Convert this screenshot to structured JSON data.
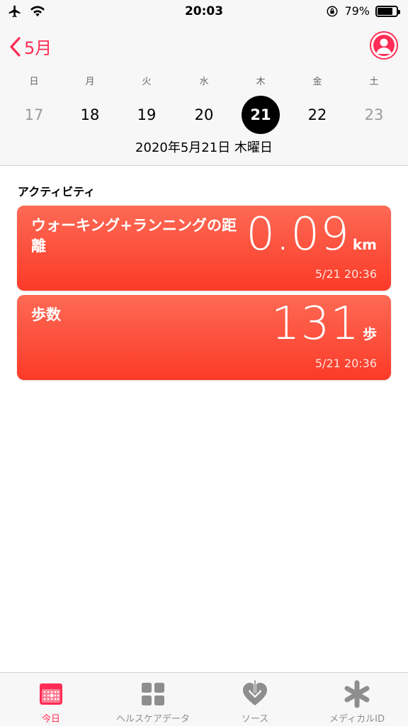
{
  "status": {
    "time": "20:03",
    "battery": "79%",
    "battery_level": 0.79
  },
  "header": {
    "back_label": "5月",
    "weekdays": [
      "日",
      "月",
      "火",
      "水",
      "木",
      "金",
      "土"
    ],
    "dates": [
      "17",
      "18",
      "19",
      "20",
      "21",
      "22",
      "23"
    ],
    "selected_date": "21",
    "full_date": "2020年5月21日 木曜日"
  },
  "section": {
    "title": "アクティビティ"
  },
  "cards": [
    {
      "title": "ウォーキング+ランニングの距離",
      "value": "0.09",
      "unit": "km",
      "timestamp": "5/21 20:36"
    },
    {
      "title": "歩数",
      "value": "131",
      "unit": "歩",
      "timestamp": "5/21 20:36"
    }
  ],
  "tabs": [
    {
      "label": "今日",
      "icon": "calendar-icon"
    },
    {
      "label": "ヘルスケアデータ",
      "icon": "grid-icon"
    },
    {
      "label": "ソース",
      "icon": "heart-download-icon"
    },
    {
      "label": "メディカルID",
      "icon": "asterisk-icon"
    }
  ],
  "colors": {
    "accent": "#ff2d55",
    "card_top": "#fd6a55",
    "card_bottom": "#fc3a28"
  }
}
